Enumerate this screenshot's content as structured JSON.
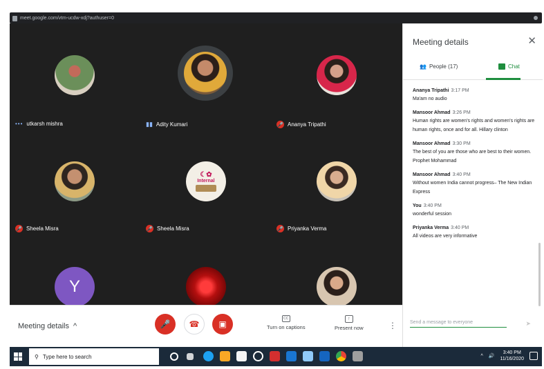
{
  "browser": {
    "url": "meet.google.com/vtm-ucdw-xdj?authuser=0"
  },
  "tiles": [
    {
      "name": "utkarsh mishra",
      "status": "dots",
      "avatar": "photo"
    },
    {
      "name": "Adity Kumari",
      "status": "speaking",
      "avatar": "photo"
    },
    {
      "name": "Ananya Tripathi",
      "status": "muted",
      "avatar": "photo"
    },
    {
      "name": "Sheela Misra",
      "status": "muted",
      "avatar": "photo"
    },
    {
      "name": "Sheela Misra",
      "status": "muted",
      "avatar": "logo"
    },
    {
      "name": "Priyanka Verma",
      "status": "muted",
      "avatar": "photo"
    },
    {
      "name": "",
      "status": "none",
      "avatar": "letter"
    },
    {
      "name": "",
      "status": "none",
      "avatar": "red"
    },
    {
      "name": "",
      "status": "none",
      "avatar": "photo"
    }
  ],
  "avatar_letter": "Y",
  "logo_text": "Internal",
  "panel": {
    "title": "Meeting details",
    "close": "✕",
    "people_tab": "People (17)",
    "chat_tab": "Chat",
    "messages": [
      {
        "author": "Ananya Tripathi",
        "time": "3:17 PM",
        "text": "Ma'am no audio"
      },
      {
        "author": "Mansoor Ahmad",
        "time": "3:26 PM",
        "text": "Human rights are women's rights and women's rights are human rights, once and for all.  Hillary clinton"
      },
      {
        "author": "Mansoor Ahmad",
        "time": "3:30 PM",
        "text": "The best of you are those who are best to their women.  Prophet Mohammad"
      },
      {
        "author": "Mansoor Ahmad",
        "time": "3:40 PM",
        "text": "Without women India cannot progress– The New Indian Express"
      },
      {
        "author": "You",
        "time": "3:40 PM",
        "text": "wonderful session"
      },
      {
        "author": "Priyanka Verma",
        "time": "3:40 PM",
        "text": "All videos are very informative"
      }
    ],
    "input_placeholder": "Send a message to everyone"
  },
  "controls": {
    "meeting_details": "Meeting details",
    "captions": "Turn on captions",
    "present": "Present now"
  },
  "taskbar": {
    "search_placeholder": "Type here to search",
    "time": "3:40 PM",
    "date": "11/16/2020"
  },
  "colors": {
    "accent": "#1e8e3e",
    "danger": "#d93025",
    "meet_bg": "#1f1f1f"
  }
}
